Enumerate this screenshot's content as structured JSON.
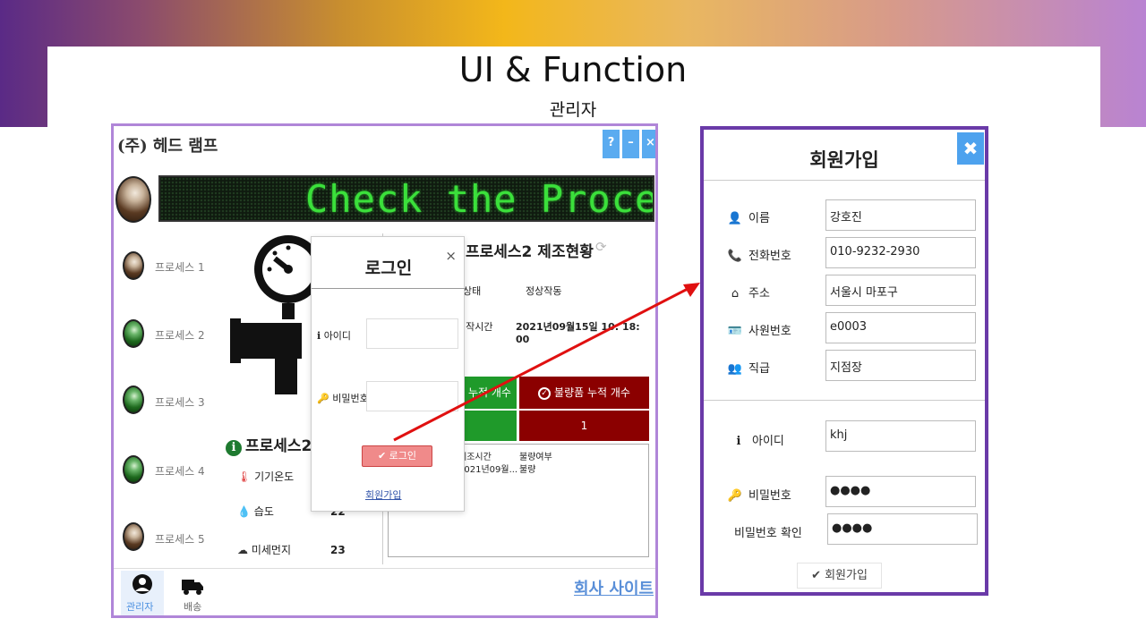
{
  "header": {
    "title": "UI & Function",
    "subtitle": "관리자"
  },
  "app": {
    "company": "(주) 헤드 램프",
    "window_buttons": [
      "?",
      "–",
      "×"
    ],
    "ticker": "Check the Process",
    "processes": [
      {
        "label": "프로세스 1",
        "status_color": "brown"
      },
      {
        "label": "프로세스 2",
        "status_color": "green"
      },
      {
        "label": "프로세스 3",
        "status_color": "green"
      },
      {
        "label": "프로세스 4",
        "status_color": "green"
      },
      {
        "label": "프로세스 5",
        "status_color": "brown"
      }
    ],
    "detail": {
      "title": "프로세스2 제조현황",
      "status_label": "상태",
      "status_value": "정상작동",
      "start_label": "시작시간",
      "start_value": "2021년09월15일 10: 18: 00",
      "good_count_label": "누적 개수",
      "bad_count_label": "불량품 누적 개수",
      "bad_count_value": "1",
      "table": {
        "headers": [
          "제조시간",
          "불량여부"
        ],
        "rows": [
          [
            "2021년09월...",
            "불량"
          ]
        ]
      }
    },
    "sensors": {
      "title": "프로세스2",
      "items": [
        {
          "label": "기기온도",
          "value": ""
        },
        {
          "label": "습도",
          "value": "22"
        },
        {
          "label": "미세먼지",
          "value": "23"
        }
      ]
    },
    "nav": {
      "admin": "관리자",
      "delivery": "배송"
    },
    "site_link": "회사 사이트"
  },
  "login": {
    "title": "로그인",
    "close": "×",
    "id_label": "아이디",
    "pw_label": "비밀번호",
    "button": "✔ 로그인",
    "signup_link": "회원가입"
  },
  "signup": {
    "title": "회원가입",
    "close": "✖",
    "fields": [
      {
        "label": "이름",
        "value": "강호진"
      },
      {
        "label": "전화번호",
        "value": "010-9232-2930"
      },
      {
        "label": "주소",
        "value": "서울시 마포구"
      },
      {
        "label": "사원번호",
        "value": "e0003"
      },
      {
        "label": "직급",
        "value": "지점장"
      }
    ],
    "id_label": "아이디",
    "id_value": "khj",
    "pw_label": "비밀번호",
    "pw_value": "●●●●",
    "pw_confirm_label": "비밀번호 확인",
    "pw_confirm_value": "●●●●",
    "button": "✔ 회원가입"
  },
  "colors": {
    "accent": "#6a3aa8",
    "button_blue": "#4da2ee",
    "good": "#1f9a2a",
    "bad": "#8b0000",
    "login_btn": "#f08a8a"
  }
}
